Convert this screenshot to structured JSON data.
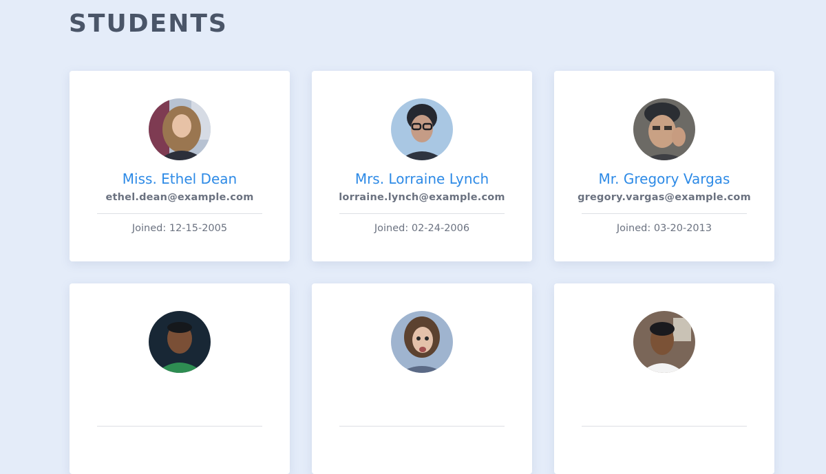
{
  "page": {
    "title": "STUDENTS"
  },
  "students": [
    {
      "name": "Miss. Ethel Dean",
      "email": "ethel.dean@example.com",
      "joined": "Joined: 12-15-2005"
    },
    {
      "name": "Mrs. Lorraine Lynch",
      "email": "lorraine.lynch@example.com",
      "joined": "Joined: 02-24-2006"
    },
    {
      "name": "Mr. Gregory Vargas",
      "email": "gregory.vargas@example.com",
      "joined": "Joined: 03-20-2013"
    },
    {
      "name": "",
      "email": "",
      "joined": ""
    },
    {
      "name": "",
      "email": "",
      "joined": ""
    },
    {
      "name": "",
      "email": "",
      "joined": ""
    }
  ],
  "colors": {
    "background": "#e4ecf9",
    "title": "#4a5568",
    "name_accent": "#2d8ae6",
    "muted_text": "#6b7280"
  }
}
